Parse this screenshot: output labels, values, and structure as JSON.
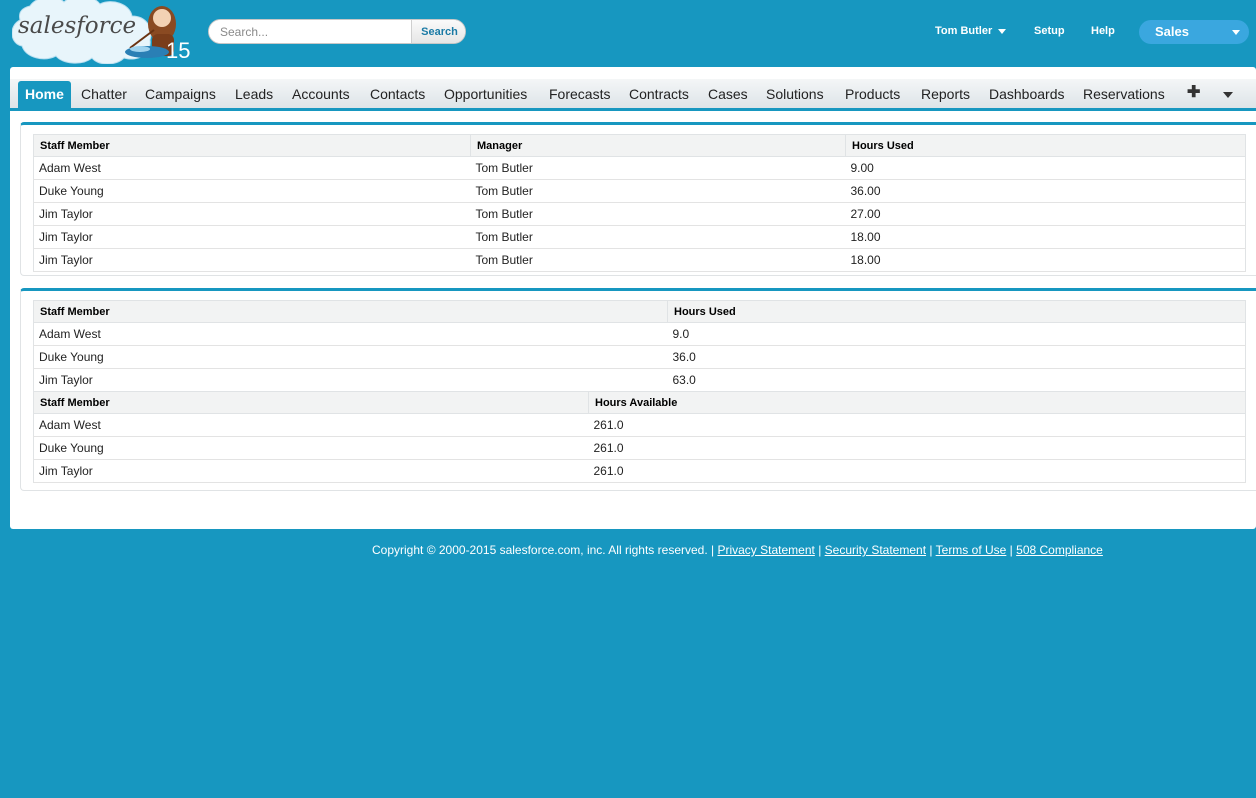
{
  "header": {
    "logo_text": "salesforce",
    "logo_badge": "15",
    "search_placeholder": "Search...",
    "search_button": "Search",
    "user_name": "Tom Butler",
    "setup_label": "Setup",
    "help_label": "Help",
    "app_name": "Sales"
  },
  "tabs": [
    {
      "label": "Home",
      "active": true
    },
    {
      "label": "Chatter"
    },
    {
      "label": "Campaigns"
    },
    {
      "label": "Leads"
    },
    {
      "label": "Accounts"
    },
    {
      "label": "Contacts"
    },
    {
      "label": "Opportunities"
    },
    {
      "label": "Forecasts"
    },
    {
      "label": "Contracts"
    },
    {
      "label": "Cases"
    },
    {
      "label": "Solutions"
    },
    {
      "label": "Products"
    },
    {
      "label": "Reports"
    },
    {
      "label": "Dashboards"
    },
    {
      "label": "Reservations"
    }
  ],
  "table1": {
    "headers": [
      "Staff Member",
      "Manager",
      "Hours Used"
    ],
    "rows": [
      [
        "Adam West",
        "Tom Butler",
        "9.00"
      ],
      [
        "Duke Young",
        "Tom Butler",
        "36.00"
      ],
      [
        "Jim Taylor",
        "Tom Butler",
        "27.00"
      ],
      [
        "Jim Taylor",
        "Tom Butler",
        "18.00"
      ],
      [
        "Jim Taylor",
        "Tom Butler",
        "18.00"
      ]
    ]
  },
  "table2": {
    "headers": [
      "Staff Member",
      "Hours Used"
    ],
    "rows": [
      [
        "Adam West",
        "9.0"
      ],
      [
        "Duke Young",
        "36.0"
      ],
      [
        "Jim Taylor",
        "63.0"
      ]
    ]
  },
  "table3": {
    "headers": [
      "Staff Member",
      "Hours Available"
    ],
    "rows": [
      [
        "Adam West",
        "261.0"
      ],
      [
        "Duke Young",
        "261.0"
      ],
      [
        "Jim Taylor",
        "261.0"
      ]
    ]
  },
  "footer": {
    "copyright": "Copyright © 2000-2015 salesforce.com, inc. All rights reserved. |",
    "privacy": "Privacy Statement",
    "security": "Security Statement",
    "terms": "Terms of Use",
    "compliance": "508 Compliance",
    "sep": "|"
  }
}
